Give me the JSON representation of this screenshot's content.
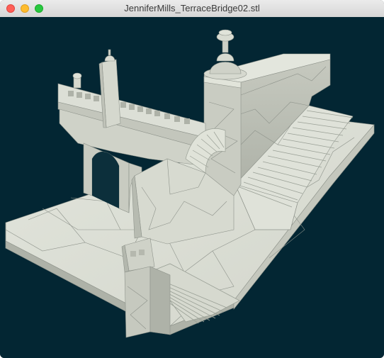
{
  "window": {
    "title": "JenniferMills_TerraceBridge02.stl",
    "buttons": {
      "close": "close-button",
      "minimize": "minimize-button",
      "zoom": "zoom-button"
    }
  },
  "viewport": {
    "background_color": "#032633",
    "model_fill_color": "#d9dcd2",
    "model_edge_color": "#8a8f87"
  }
}
